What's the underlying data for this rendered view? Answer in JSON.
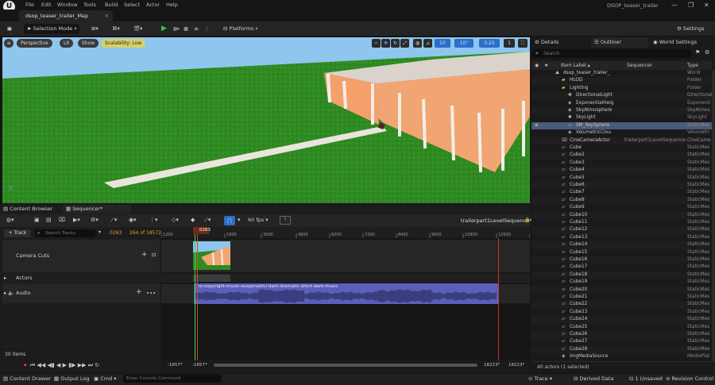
{
  "app": {
    "window_title": "DSOP_teaser_trailer",
    "logo": "U"
  },
  "menu": [
    "File",
    "Edit",
    "Window",
    "Tools",
    "Build",
    "Select",
    "Actor",
    "Help"
  ],
  "window_controls": [
    "—",
    "❐",
    "✕"
  ],
  "doc_tab": {
    "label": "dsop_teaser_trailer_Map"
  },
  "toolbar": {
    "selection_mode": "Selection Mode",
    "platforms": "Platforms",
    "settings": "Settings"
  },
  "viewport": {
    "perspective": "Perspective",
    "lit": "Lit",
    "show": "Show",
    "scalability": "Scalability: Low",
    "grid_snap": "10",
    "rot_snap": "10°",
    "scale_snap": "0.25",
    "cam_speed": "1",
    "colors": {
      "grass": "#2f8a22",
      "sky": "#8ec6ee",
      "wall": "#f0a572",
      "roof": "#d9d3cc"
    }
  },
  "right_panel": {
    "tabs": [
      "Details",
      "Outliner",
      "World Settings"
    ],
    "search_placeholder": "Search",
    "columns": {
      "label": "Item Label ▴",
      "sequencer": "Sequencer",
      "type": "Type"
    },
    "rows": [
      {
        "label": "dsop_teaser_trailer_",
        "type": "World",
        "indent": 0,
        "kind": "world"
      },
      {
        "label": "HLOD",
        "type": "Folder",
        "indent": 1,
        "kind": "folder"
      },
      {
        "label": "Lighting",
        "type": "Folder",
        "indent": 1,
        "kind": "folder"
      },
      {
        "label": "DirectionalLight",
        "type": "Directional",
        "indent": 2,
        "kind": "light"
      },
      {
        "label": "ExponentialHeig",
        "type": "Exponenti",
        "indent": 2,
        "kind": "actor"
      },
      {
        "label": "SkyAtmosphere",
        "type": "SkyAtmos",
        "indent": 2,
        "kind": "actor"
      },
      {
        "label": "SkyLight",
        "type": "SkyLight",
        "indent": 2,
        "kind": "light"
      },
      {
        "label": "SM_SkySphere",
        "type": "StaticMes",
        "indent": 2,
        "kind": "mesh",
        "selected": true
      },
      {
        "label": "VolumetricClou",
        "type": "Volumetri",
        "indent": 2,
        "kind": "actor"
      },
      {
        "label": "CineCameraActor",
        "type": "CineCame",
        "indent": 1,
        "kind": "camera",
        "sequencer": "trailerpart1LevelSequence"
      },
      {
        "label": "Cube",
        "type": "StaticMes",
        "indent": 1,
        "kind": "mesh"
      },
      {
        "label": "Cube2",
        "type": "StaticMes",
        "indent": 1,
        "kind": "mesh"
      },
      {
        "label": "Cube3",
        "type": "StaticMes",
        "indent": 1,
        "kind": "mesh"
      },
      {
        "label": "Cube4",
        "type": "StaticMes",
        "indent": 1,
        "kind": "mesh"
      },
      {
        "label": "Cube5",
        "type": "StaticMes",
        "indent": 1,
        "kind": "mesh"
      },
      {
        "label": "Cube6",
        "type": "StaticMes",
        "indent": 1,
        "kind": "mesh"
      },
      {
        "label": "Cube7",
        "type": "StaticMes",
        "indent": 1,
        "kind": "mesh"
      },
      {
        "label": "Cube8",
        "type": "StaticMes",
        "indent": 1,
        "kind": "mesh"
      },
      {
        "label": "Cube9",
        "type": "StaticMes",
        "indent": 1,
        "kind": "mesh"
      },
      {
        "label": "Cube10",
        "type": "StaticMes",
        "indent": 1,
        "kind": "mesh"
      },
      {
        "label": "Cube11",
        "type": "StaticMes",
        "indent": 1,
        "kind": "mesh"
      },
      {
        "label": "Cube12",
        "type": "StaticMes",
        "indent": 1,
        "kind": "mesh"
      },
      {
        "label": "Cube13",
        "type": "StaticMes",
        "indent": 1,
        "kind": "mesh"
      },
      {
        "label": "Cube14",
        "type": "StaticMes",
        "indent": 1,
        "kind": "mesh"
      },
      {
        "label": "Cube15",
        "type": "StaticMes",
        "indent": 1,
        "kind": "mesh"
      },
      {
        "label": "Cube16",
        "type": "StaticMes",
        "indent": 1,
        "kind": "mesh"
      },
      {
        "label": "Cube17",
        "type": "StaticMes",
        "indent": 1,
        "kind": "mesh"
      },
      {
        "label": "Cube18",
        "type": "StaticMes",
        "indent": 1,
        "kind": "mesh"
      },
      {
        "label": "Cube19",
        "type": "StaticMes",
        "indent": 1,
        "kind": "mesh"
      },
      {
        "label": "Cube20",
        "type": "StaticMes",
        "indent": 1,
        "kind": "mesh"
      },
      {
        "label": "Cube21",
        "type": "StaticMes",
        "indent": 1,
        "kind": "mesh"
      },
      {
        "label": "Cube22",
        "type": "StaticMes",
        "indent": 1,
        "kind": "mesh"
      },
      {
        "label": "Cube23",
        "type": "StaticMes",
        "indent": 1,
        "kind": "mesh"
      },
      {
        "label": "Cube24",
        "type": "StaticMes",
        "indent": 1,
        "kind": "mesh"
      },
      {
        "label": "Cube25",
        "type": "StaticMes",
        "indent": 1,
        "kind": "mesh"
      },
      {
        "label": "Cube26",
        "type": "StaticMes",
        "indent": 1,
        "kind": "mesh"
      },
      {
        "label": "Cube27",
        "type": "StaticMes",
        "indent": 1,
        "kind": "mesh"
      },
      {
        "label": "Cube28",
        "type": "StaticMes",
        "indent": 1,
        "kind": "mesh"
      },
      {
        "label": "ImgMediaSource",
        "type": "MediaPlat",
        "indent": 1,
        "kind": "actor"
      }
    ],
    "footer": "40 actors (1 selected)"
  },
  "bottom": {
    "tabs": [
      "Content Browser",
      "Sequencer*"
    ],
    "sequence_name": "trailerpart1LevelSequence*",
    "fps": "60 fps",
    "add_track": "+ Track",
    "search_placeholder": "Search Tracks",
    "current_frame": "0263",
    "frame_of": "264 of 18572",
    "tracks": [
      "Camera Cuts",
      "Actors",
      "Audio"
    ],
    "ruler_ticks": [
      "1200",
      "0263",
      "1800",
      "3000",
      "4800",
      "6000",
      "7200",
      "8400",
      "9600",
      "10800",
      "12600",
      "15600",
      "16800"
    ],
    "playhead_label": "0263",
    "audio_clip": "no-copyright-music-suspenseful-dark-dramatic-short-dark-music",
    "range_start": "-1657*",
    "range_start2": "-1657*",
    "range_end": "18223*",
    "range_end2": "18223*",
    "item_count": "30 items"
  },
  "statusbar": {
    "content_drawer": "Content Drawer",
    "output_log": "Output Log",
    "cmd": "Cmd",
    "console_placeholder": "Enter Console Command",
    "trace": "Trace",
    "derived_data": "Derived Data",
    "unsaved": "1 Unsaved",
    "revision": "Revision Control"
  }
}
